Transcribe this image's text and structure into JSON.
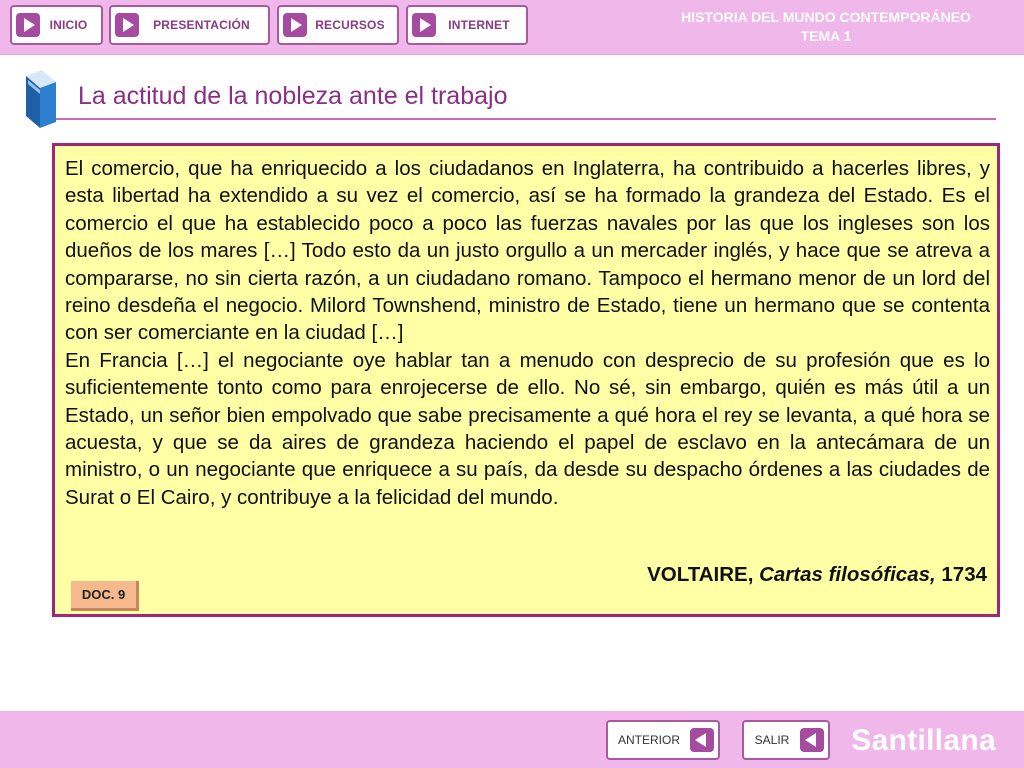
{
  "nav": {
    "inicio": "INICIO",
    "presentacion": "PRESENTACIÓN",
    "recursos": "RECURSOS",
    "internet": "INTERNET"
  },
  "header": {
    "line1": "HISTORIA DEL MUNDO CONTEMPORÁNEO",
    "line2": "TEMA 1"
  },
  "page": {
    "title": "La actitud de la nobleza ante el trabajo"
  },
  "document": {
    "paragraph1": "El comercio, que ha enriquecido a los ciudadanos en Inglaterra, ha contribuido a hacerles libres, y esta libertad ha extendido a su vez el comercio, así se ha formado la grandeza del Estado. Es el comercio el que ha establecido poco a poco las fuerzas navales por las que los ingleses son los dueños de los mares […] Todo esto da un justo orgullo a un mercader inglés, y hace que se atreva a compararse, no sin cierta razón, a un ciudadano romano. Tampoco el hermano menor de un lord del reino desdeña el negocio. Milord Townshend, ministro de Estado, tiene un hermano que se contenta con ser comerciante en la ciudad […]",
    "paragraph2": "En Francia […] el negociante oye hablar tan a menudo con desprecio de su profesión que es lo suficientemente tonto como para enrojecerse de ello. No sé, sin embargo, quién es más útil a un Estado, un señor bien empolvado que sabe precisamente a qué hora el rey se levanta, a qué hora se acuesta, y que se da aires de grandeza haciendo el papel de esclavo en la antecámara de un ministro, o un negociante que enriquece a su país, da desde su despacho órdenes a las ciudades de Surat o El Cairo, y contribuye a la felicidad del mundo.",
    "author": "VOLTAIRE,",
    "work": "Cartas filosóficas,",
    "year": "1734",
    "badge": "DOC. 9"
  },
  "footer": {
    "anterior": "ANTERIOR",
    "salir": "SALIR",
    "brand": "Santillana"
  },
  "colors": {
    "bar": "#efb7ea",
    "accent": "#a64ca0",
    "title": "#8a2f87",
    "doc_bg": "#ffffa6",
    "doc_border": "#a0267c",
    "badge": "#f5b98d"
  },
  "icons": {
    "nav": "play-arrow-icon",
    "footer": "back-arrow-icon",
    "title": "book-icon"
  }
}
